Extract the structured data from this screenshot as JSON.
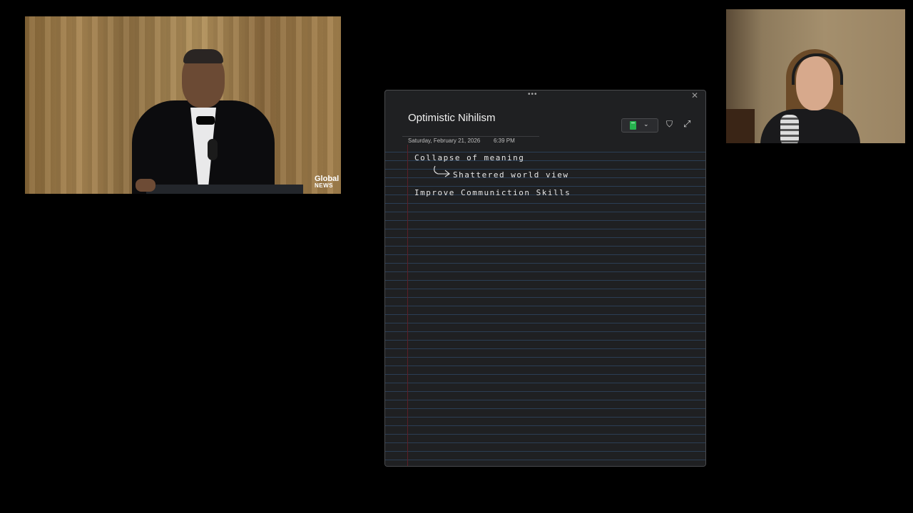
{
  "video_left": {
    "logo_line1": "Global",
    "logo_line2": "NEWS"
  },
  "notes": {
    "title": "Optimistic Nihilism",
    "date": "Saturday, February 21, 2026",
    "time": "6:39 PM",
    "drag_handle": "•••",
    "close_icon": "✕",
    "section_chevron": "⌄",
    "filter_icon": "⛉",
    "expand_icon": "⤢",
    "section_color": "#27b34f",
    "ink": {
      "line1": "Collapse of meaning",
      "line2": "Shattered world view",
      "line3": "Improve Communiction Skills"
    }
  }
}
